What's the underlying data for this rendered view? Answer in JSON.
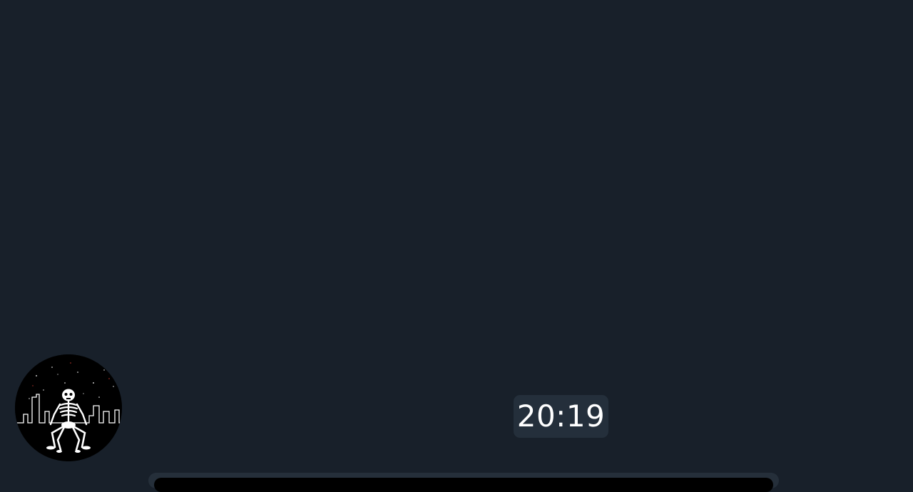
{
  "chat": {
    "time": "20:19"
  },
  "avatar": {
    "icon": "skeleton-city-avatar-icon"
  },
  "colors": {
    "background": "#18202a",
    "badge": "#242f3b",
    "text": "#ffffff"
  }
}
